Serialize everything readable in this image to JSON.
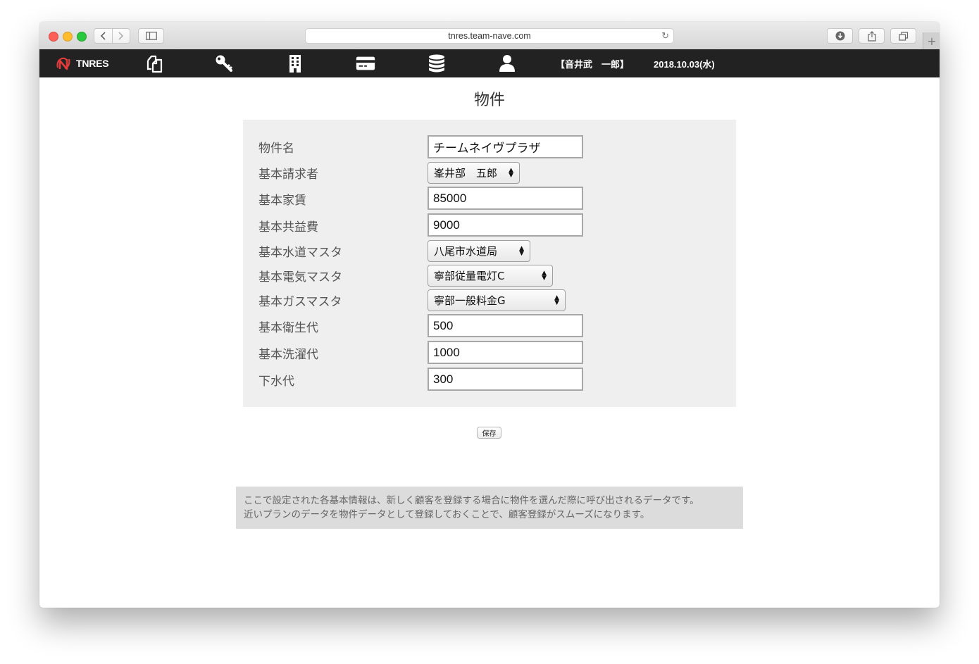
{
  "browser": {
    "url": "tnres.team-nave.com"
  },
  "appnav": {
    "logo_text": "TNRES",
    "icons": [
      "documents-icon",
      "key-icon",
      "building-icon",
      "card-icon",
      "database-icon",
      "user-icon"
    ],
    "username": "【音井武　一郎】",
    "date": "2018.10.03(水)"
  },
  "page": {
    "title": "物件"
  },
  "form": {
    "property_name": {
      "label": "物件名",
      "value": "チームネイヴプラザ"
    },
    "billing": {
      "label": "基本請求者",
      "value": "峯井部　五郎"
    },
    "rent": {
      "label": "基本家賃",
      "value": "85000"
    },
    "common_fee": {
      "label": "基本共益費",
      "value": "9000"
    },
    "water": {
      "label": "基本水道マスタ",
      "value": "八尾市水道局"
    },
    "electric": {
      "label": "基本電気マスタ",
      "value": "寧部従量電灯C"
    },
    "gas": {
      "label": "基本ガスマスタ",
      "value": "寧部一般料金G"
    },
    "sanitation": {
      "label": "基本衛生代",
      "value": "500"
    },
    "laundry": {
      "label": "基本洗濯代",
      "value": "1000"
    },
    "sewer": {
      "label": "下水代",
      "value": "300"
    }
  },
  "actions": {
    "save_label": "保存"
  },
  "note": {
    "line1": "ここで設定された各基本情報は、新しく顧客を登録する場合に物件を選んだ際に呼び出されるデータです。",
    "line2": "近いプランのデータを物件データとして登録しておくことで、顧客登録がスムーズになります。"
  }
}
